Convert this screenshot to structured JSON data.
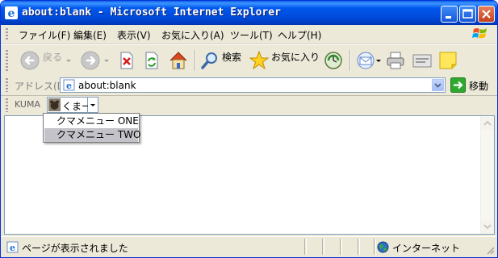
{
  "window": {
    "title": "about:blank - Microsoft Internet Explorer"
  },
  "menubar": {
    "items": [
      "ファイル(F)",
      "編集(E)",
      "表示(V)",
      "お気に入り(A)",
      "ツール(T)",
      "ヘルプ(H)"
    ]
  },
  "toolbar": {
    "back_label": "戻る",
    "search_label": "検索",
    "favorites_label": "お気に入り"
  },
  "address": {
    "label": "アドレス(D)",
    "value": "about:blank",
    "go_label": "移動"
  },
  "links": {
    "label": "KUMA",
    "button_label": "くまー"
  },
  "dropdown": {
    "items": [
      "クマメニュー ONE",
      "クマメニュー TWO"
    ],
    "selected_index": 1
  },
  "status": {
    "text": "ページが表示されました",
    "zone": "インターネット"
  }
}
